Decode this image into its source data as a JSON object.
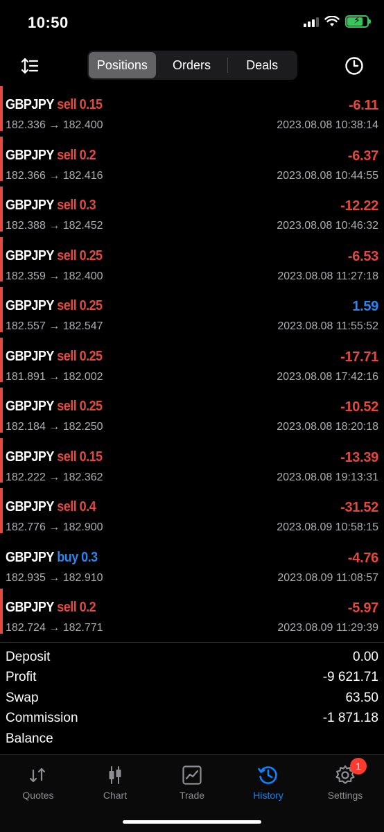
{
  "status": {
    "time": "10:50"
  },
  "nav": {
    "tabs": [
      "Positions",
      "Orders",
      "Deals"
    ],
    "active_tab": "Positions"
  },
  "colors": {
    "sell": "#e5483e",
    "buy": "#2d86f0",
    "loss": "#e5483e",
    "gain": "#2d86f0",
    "active": "#0a84ff"
  },
  "positions": [
    {
      "symbol": "GBPJPY",
      "side": "sell",
      "volume": "0.15",
      "prices": "182.336 → 182.400",
      "profit": "-6.11",
      "time": "2023.08.08 10:38:14"
    },
    {
      "symbol": "GBPJPY",
      "side": "sell",
      "volume": "0.2",
      "prices": "182.366 → 182.416",
      "profit": "-6.37",
      "time": "2023.08.08 10:44:55"
    },
    {
      "symbol": "GBPJPY",
      "side": "sell",
      "volume": "0.3",
      "prices": "182.388 → 182.452",
      "profit": "-12.22",
      "time": "2023.08.08 10:46:32"
    },
    {
      "symbol": "GBPJPY",
      "side": "sell",
      "volume": "0.25",
      "prices": "182.359 → 182.400",
      "profit": "-6.53",
      "time": "2023.08.08 11:27:18"
    },
    {
      "symbol": "GBPJPY",
      "side": "sell",
      "volume": "0.25",
      "prices": "182.557 → 182.547",
      "profit": "1.59",
      "time": "2023.08.08 11:55:52"
    },
    {
      "symbol": "GBPJPY",
      "side": "sell",
      "volume": "0.25",
      "prices": "181.891 → 182.002",
      "profit": "-17.71",
      "time": "2023.08.08 17:42:16"
    },
    {
      "symbol": "GBPJPY",
      "side": "sell",
      "volume": "0.25",
      "prices": "182.184 → 182.250",
      "profit": "-10.52",
      "time": "2023.08.08 18:20:18"
    },
    {
      "symbol": "GBPJPY",
      "side": "sell",
      "volume": "0.15",
      "prices": "182.222 → 182.362",
      "profit": "-13.39",
      "time": "2023.08.08 19:13:31"
    },
    {
      "symbol": "GBPJPY",
      "side": "sell",
      "volume": "0.4",
      "prices": "182.776 → 182.900",
      "profit": "-31.52",
      "time": "2023.08.09 10:58:15"
    },
    {
      "symbol": "GBPJPY",
      "side": "buy",
      "volume": "0.3",
      "prices": "182.935 → 182.910",
      "profit": "-4.76",
      "time": "2023.08.09 11:08:57"
    },
    {
      "symbol": "GBPJPY",
      "side": "sell",
      "volume": "0.2",
      "prices": "182.724 → 182.771",
      "profit": "-5.97",
      "time": "2023.08.09 11:29:39"
    }
  ],
  "summary": [
    {
      "label": "Deposit",
      "value": "0.00"
    },
    {
      "label": "Profit",
      "value": "-9 621.71"
    },
    {
      "label": "Swap",
      "value": "63.50"
    },
    {
      "label": "Commission",
      "value": "-1 871.18"
    },
    {
      "label": "Balance",
      "value": ""
    }
  ],
  "tab_bar": {
    "items": [
      {
        "label": "Quotes",
        "icon": "quotes-arrows-icon"
      },
      {
        "label": "Chart",
        "icon": "candlestick-icon"
      },
      {
        "label": "Trade",
        "icon": "trade-chart-icon"
      },
      {
        "label": "History",
        "icon": "history-icon"
      },
      {
        "label": "Settings",
        "icon": "gear-icon"
      }
    ],
    "active": "History",
    "settings_badge": "1"
  }
}
